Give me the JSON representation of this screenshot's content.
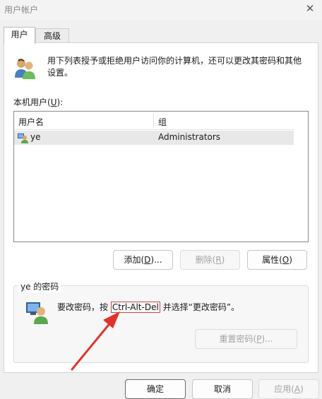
{
  "window": {
    "title": "用户帐户",
    "close_icon": "close-icon"
  },
  "tabs": [
    {
      "label": "用户",
      "active": true
    },
    {
      "label": "高级",
      "active": false
    }
  ],
  "description": "用下列表授予或拒绝用户访问你的计算机，还可以更改其密码和其他设置。",
  "users_list": {
    "label_prefix": "本机用户(",
    "label_accel": "U",
    "label_suffix": "):",
    "columns": [
      "用户名",
      "组"
    ],
    "rows": [
      {
        "name": "ye",
        "group": "Administrators"
      }
    ]
  },
  "buttons": {
    "add": {
      "prefix": "添加(",
      "accel": "D",
      "suffix": ")..."
    },
    "remove": {
      "prefix": "删除(",
      "accel": "R",
      "suffix": ")"
    },
    "properties": {
      "prefix": "属性(",
      "accel": "O",
      "suffix": ")"
    }
  },
  "password_group": {
    "title": "ye 的密码",
    "text_before": "要改密码，按 ",
    "text_key": "Ctrl-Alt-Del",
    "text_after": " 并选择“更改密码”。",
    "reset_button": {
      "prefix": "重置密码(",
      "accel": "P",
      "suffix": ")..."
    }
  },
  "footer": {
    "ok": "确定",
    "cancel": "取消",
    "apply": {
      "prefix": "应用(",
      "accel": "A",
      "suffix": ")"
    }
  },
  "colors": {
    "highlight": "#d84343",
    "selected_row": "#e8e8e8"
  }
}
